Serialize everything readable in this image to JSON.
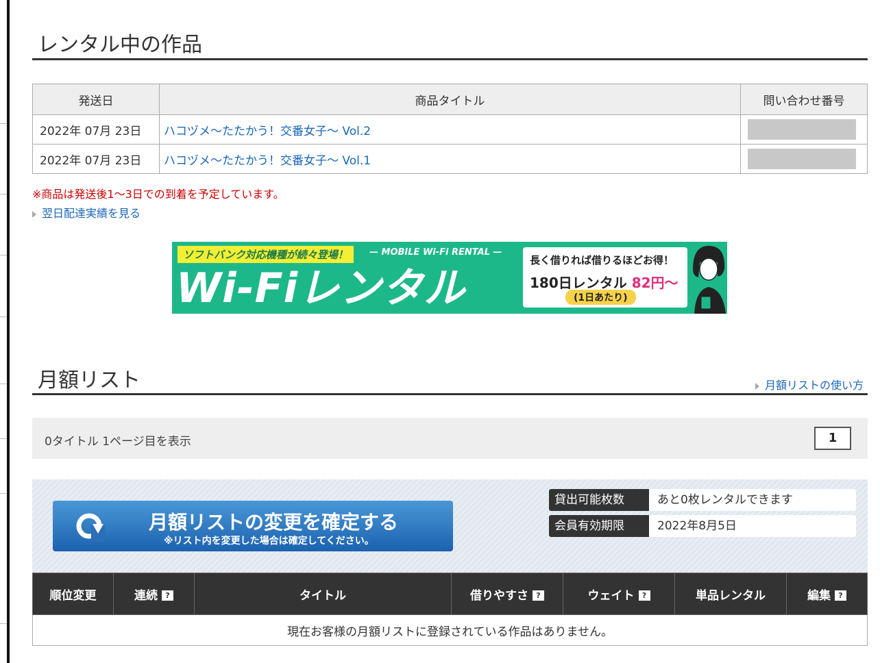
{
  "rental_section": {
    "title": "レンタル中の作品",
    "headers": [
      "発送日",
      "商品タイトル",
      "問い合わせ番号"
    ],
    "rows": [
      {
        "date": "2022年 07月 23日",
        "title": "ハコヅメ〜たたかう！交番女子〜 Vol.2"
      },
      {
        "date": "2022年 07月 23日",
        "title": "ハコヅメ〜たたかう！交番女子〜 Vol.1"
      }
    ],
    "note": "※商品は発送後1〜3日での到着を予定しています。",
    "next_day_link": "翌日配達実績を見る"
  },
  "banner": {
    "tag": "ソフトバンク対応機種が続々登場！",
    "sub": "— MOBILE Wi-Fi RENTAL —",
    "big": "Wi-Fiレンタル",
    "line1": "長く借りれば借りるほどお得！",
    "line2a": "180日レンタル",
    "line2b": "82円〜",
    "line3": "(1日あたり)"
  },
  "monthly_section": {
    "title": "月額リスト",
    "howto_link": "月額リストの使い方",
    "pager_info": "0タイトル 1ページ目を表示",
    "page_number": "1",
    "confirm_title": "月額リストの変更を確定する",
    "confirm_sub": "※リスト内を変更した場合は確定してください。",
    "info": [
      {
        "key": "貸出可能枚数",
        "value": "あと0枚レンタルできます"
      },
      {
        "key": "会員有効期限",
        "value": "2022年8月5日"
      }
    ],
    "headers": [
      "順位変更",
      "連続",
      "タイトル",
      "借りやすさ",
      "ウェイト",
      "単品レンタル",
      "編集"
    ],
    "empty_message": "現在お客様の月額リストに登録されている作品はありません。",
    "help_glyph": "?"
  }
}
